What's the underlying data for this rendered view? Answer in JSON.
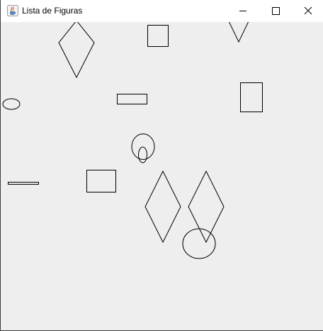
{
  "window": {
    "title": "Lista de Figuras",
    "icon": "java-cup-icon",
    "controls": {
      "minimize_icon": "minimize-icon",
      "maximize_icon": "maximize-icon",
      "close_icon": "close-icon"
    }
  },
  "canvas": {
    "background": "#eeeeee",
    "stroke_color": "#000000",
    "shape_types": [
      "diamond",
      "rectangle",
      "triangle",
      "ellipse"
    ]
  }
}
